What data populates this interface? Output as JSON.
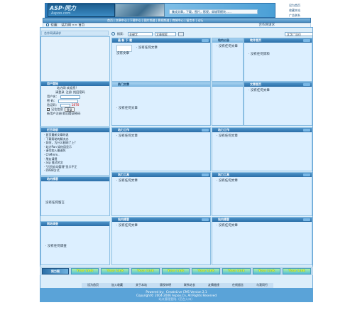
{
  "header": {
    "logo_text": "ASP·同力",
    "logo_sub": "Aspoo.com",
    "slogan": "集成文章，下载，图片，影视，商城等模块……",
    "top_links": [
      "设为首页",
      "收藏本站",
      "广告联系"
    ]
  },
  "nav": {
    "items": [
      "首页",
      "文章中心",
      "下载中心",
      "图片频道",
      "影视频道",
      "商城中心",
      "留言本",
      "论坛"
    ]
  },
  "breadcrumb": {
    "text": "位置：  站力网 >> 首页",
    "right": "合作网请求"
  },
  "placeholder_bar": "合作网请请求",
  "search": {
    "label": "搜索：",
    "input_value": "关键字",
    "select_value": "文章搜索",
    "ad_text": "文字广告位"
  },
  "panels": [
    {
      "title": "最 新 下 载",
      "items": [
        "没有任何文章"
      ],
      "extra": "没有文章"
    },
    {
      "title": "站内公告",
      "items": [
        "没有任何文章"
      ]
    },
    {
      "title": "软件首页",
      "items": [
        "没有任何资料"
      ]
    },
    {
      "title": "热门文章",
      "items": [
        "没有任何文章"
      ]
    },
    {
      "title": "文章首页",
      "items": [
        "没有任何文章"
      ]
    },
    {
      "title": "栏目导航",
      "items": [
        "首页最新文章的说",
        "下载帮助的解决办",
        "如何，为什么割网了上?",
        "站力Pan 如何用显示",
        "请勿加入最速死",
        "ChMmm..",
        "朋友请提",
        "asp 链式的文",
        "*后到自动管理*显示不正",
        "DVBB方式"
      ]
    },
    {
      "title": "站力工作",
      "items": [
        "没有任何文章"
      ]
    },
    {
      "title": "站力工作",
      "items": [
        "没有任何文章"
      ]
    },
    {
      "title": "站力工具",
      "items": [
        "没有任何文章"
      ]
    },
    {
      "title": "站力工具",
      "items": [
        "没有任何文章"
      ]
    },
    {
      "title": "站内播客",
      "items": [
        "没有任何留言"
      ]
    },
    {
      "title": "站内播客",
      "items": [
        "没有任何文章"
      ]
    },
    {
      "title": "站内播客",
      "items": [
        "没有任何文章"
      ]
    },
    {
      "title": "网站调查",
      "items": [
        "没有任何调查"
      ]
    }
  ],
  "login": {
    "title": "用户登陆",
    "greet": "站力网 欢迎您!",
    "links": [
      "请登录",
      "注册",
      "找回密码"
    ],
    "user_label": "用户名：",
    "pass_label": "密  码：",
    "code_label": "验证码：",
    "code_value": "1870",
    "remember": "记住信息",
    "login_btn": "登录",
    "bottom": "新用户注册  取回登录密码"
  },
  "linkbar": {
    "logo": "同力网",
    "items": [
      "Your Link",
      "Your Link",
      "Your Link",
      "Your Link",
      "Your Link",
      "Your Link",
      "Your Link",
      "Your Link"
    ]
  },
  "footer_links": [
    "设为首页",
    "加入收藏",
    "关于本站",
    "版权申明",
    "联系站长",
    "友情链接",
    "在线留言",
    "与我同行"
  ],
  "footer": {
    "line1": "Powered by：CreateLive CMS Version 2.1",
    "line2": "Copyright© 2004-2006 Aspoo.Cn, All Rights Reserved",
    "line3": "站点管理登陆（后台入口）"
  }
}
